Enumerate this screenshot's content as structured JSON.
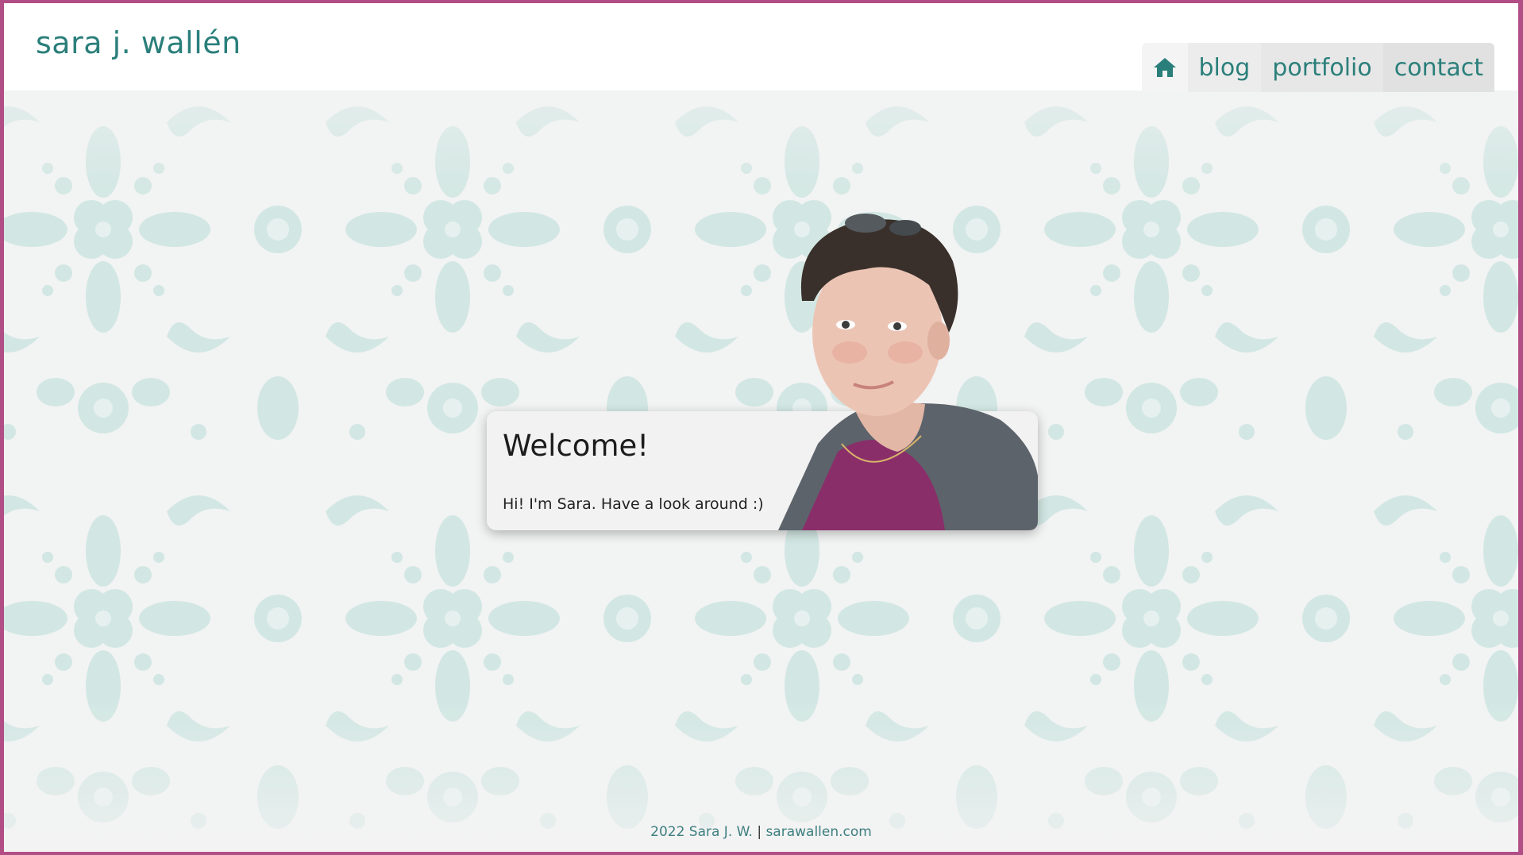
{
  "header": {
    "site_title": "sara j. wallén"
  },
  "nav": {
    "home_icon": "home-icon",
    "items": [
      {
        "label": "blog"
      },
      {
        "label": "portfolio"
      },
      {
        "label": "contact"
      }
    ]
  },
  "welcome": {
    "title": "Welcome!",
    "text": "Hi! I'm Sara. Have a look around :)"
  },
  "footer": {
    "copyright": "2022 Sara J. W.",
    "separator": "|",
    "link": "sarawallen.com"
  },
  "colors": {
    "border": "#b24e86",
    "accent": "#2b7f7b",
    "background": "#f3f3f3",
    "pattern": "#cfe5e1"
  }
}
